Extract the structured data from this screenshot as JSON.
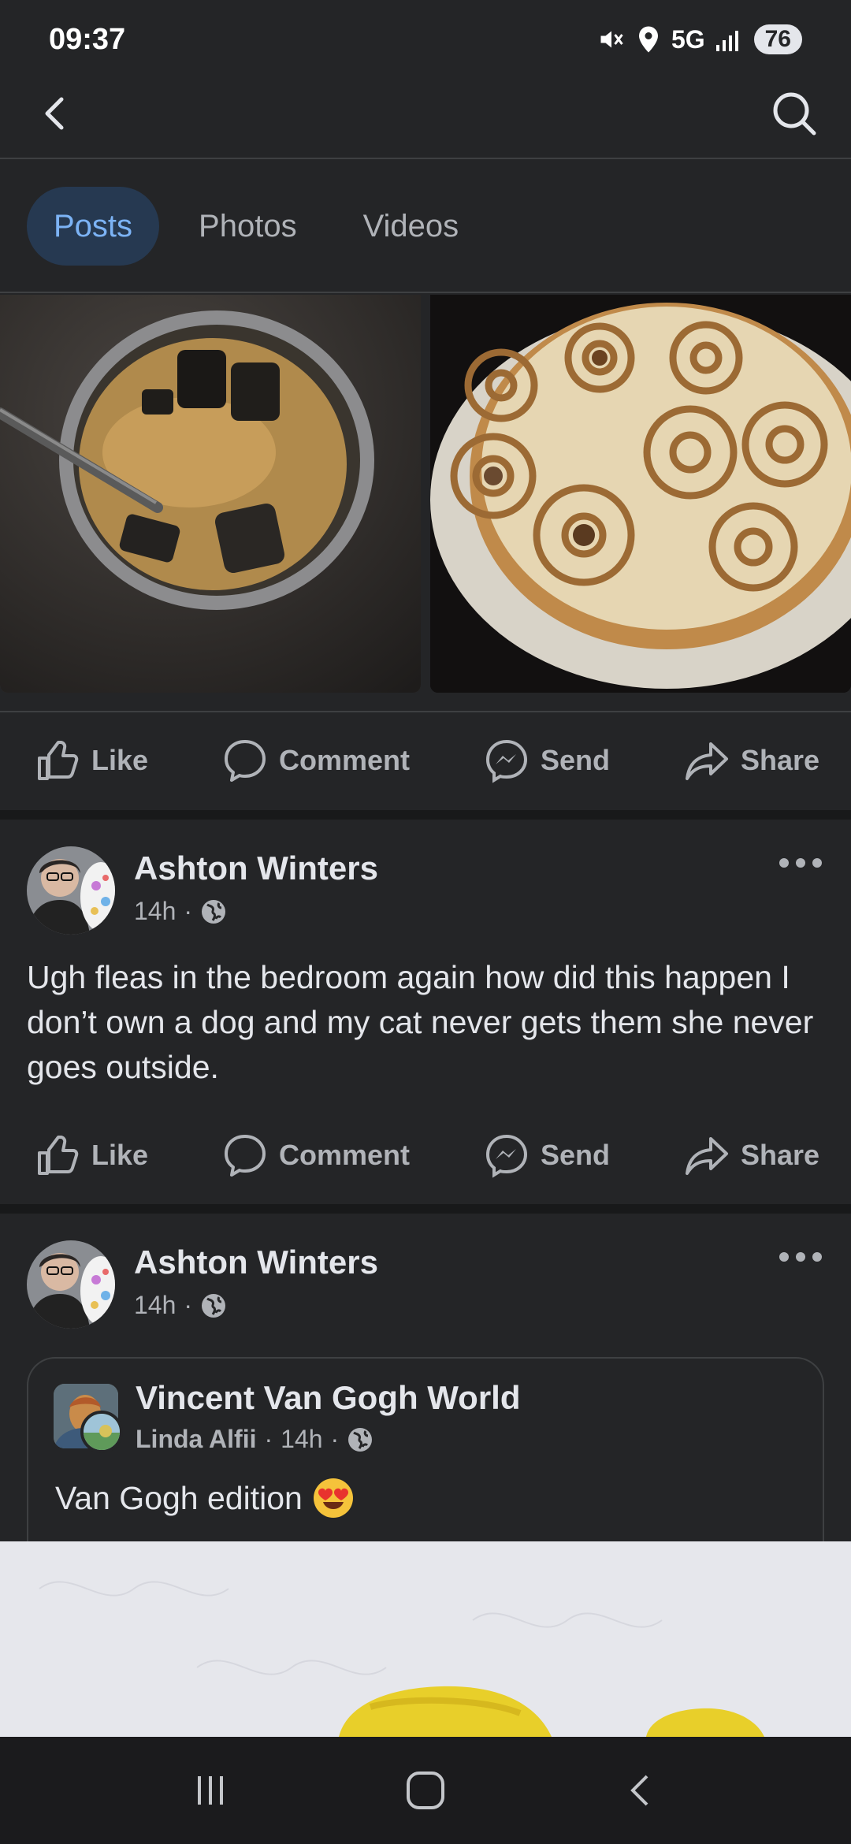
{
  "status_bar": {
    "time": "09:37",
    "network": "5G",
    "battery": "76"
  },
  "tabs": [
    {
      "label": "Posts",
      "active": true
    },
    {
      "label": "Photos",
      "active": false
    },
    {
      "label": "Videos",
      "active": false
    }
  ],
  "actions": {
    "like": "Like",
    "comment": "Comment",
    "send": "Send",
    "share": "Share"
  },
  "post1": {
    "author": "Ashton Winters",
    "time": "14h",
    "text": "Ugh fleas in the bedroom again how did this happen I don’t own a dog and my cat never gets them she never goes outside."
  },
  "post2": {
    "author": "Ashton Winters",
    "time": "14h",
    "shared": {
      "page_name": "Vincent Van Gogh World",
      "poster": "Linda Alfii",
      "time": "14h",
      "text": "Van Gogh edition"
    }
  },
  "colors": {
    "background": "#242527",
    "accent_tab_bg": "#263951",
    "accent_tab_text": "#7cb3f5",
    "text_secondary": "#b0b3b8"
  }
}
